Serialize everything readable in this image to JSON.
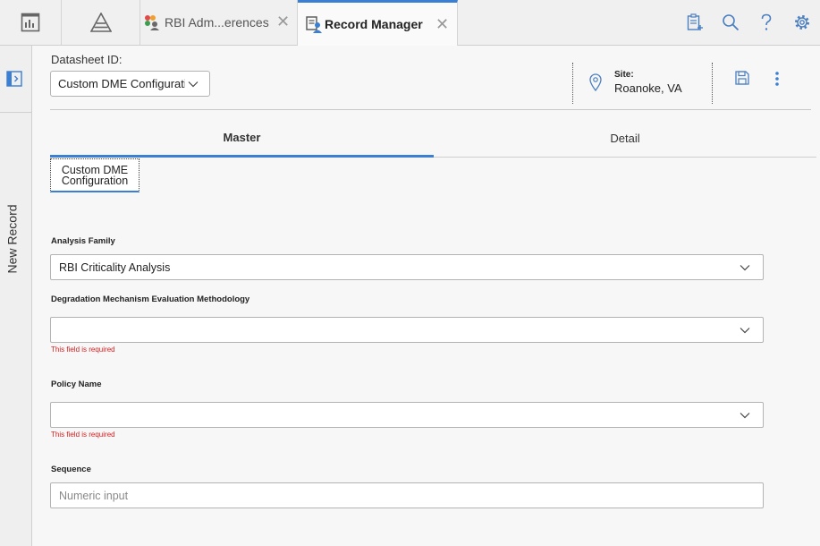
{
  "tabs": [
    {
      "label": "RBI Adm...erences"
    },
    {
      "label": "Record Manager"
    }
  ],
  "rail": {
    "label": "New Record"
  },
  "header": {
    "datasheet_label": "Datasheet ID:",
    "datasheet_value": "Custom DME Configuratic",
    "site_label": "Site:",
    "site_value": "Roanoke, VA"
  },
  "view_tabs": [
    {
      "label": "Master"
    },
    {
      "label": "Detail"
    }
  ],
  "section_tab": {
    "line1": "Custom DME",
    "line2": "Configuration"
  },
  "form": {
    "analysis_family": {
      "label": "Analysis Family",
      "value": "RBI Criticality Analysis"
    },
    "dme_methodology": {
      "label": "Degradation Mechanism Evaluation Methodology",
      "value": "",
      "error": "This field is required"
    },
    "policy_name": {
      "label": "Policy Name",
      "value": "",
      "error": "This field is required"
    },
    "sequence": {
      "label": "Sequence",
      "placeholder": "Numeric input"
    }
  },
  "colors": {
    "accent": "#3b7fd4",
    "error": "#d02020",
    "icon": "#4a7fc1"
  }
}
